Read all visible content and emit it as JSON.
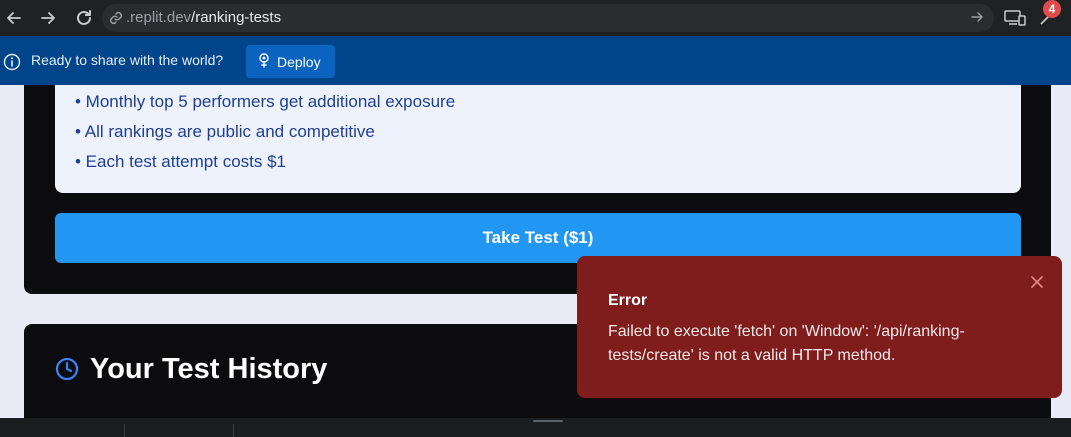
{
  "browser": {
    "url_domain": ".replit.dev",
    "url_path": "/ranking-tests",
    "extension_badge": "4"
  },
  "banner": {
    "message": "Ready to share with the world?",
    "deploy_label": "Deploy"
  },
  "page": {
    "bullets": [
      "• Monthly top 5 performers get additional exposure",
      "• All rankings are public and competitive",
      "• Each test attempt costs $1"
    ],
    "take_test_label": "Take Test ($1)",
    "history_title": "Your Test History"
  },
  "toast": {
    "title": "Error",
    "message": "Failed to execute 'fetch' on 'Window': '/api/ranking-tests/create' is not a valid HTTP method."
  },
  "colors": {
    "accent": "#2196f3",
    "error": "#7f1d1d",
    "banner": "#00448a"
  },
  "icons": [
    "back-icon",
    "forward-icon",
    "reload-icon",
    "link-icon",
    "go-icon",
    "devices-icon",
    "extension-icon",
    "info-icon",
    "deploy-icon",
    "clock-icon",
    "close-icon"
  ]
}
